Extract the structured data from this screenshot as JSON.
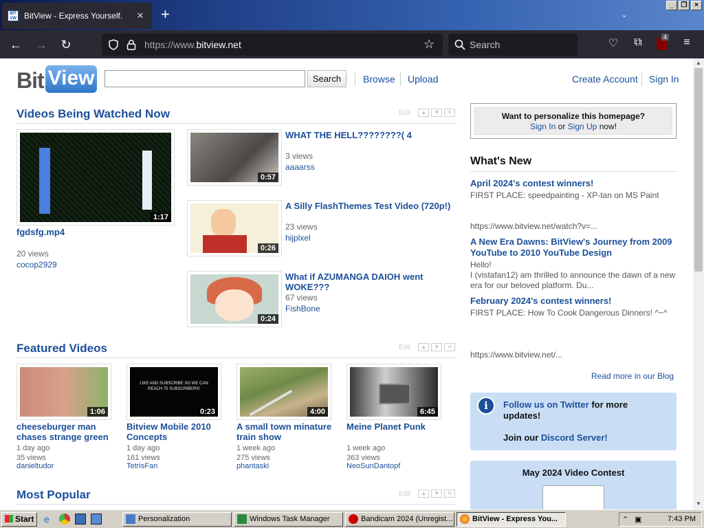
{
  "browser": {
    "tab_title": "BitView - Express Yourself.",
    "url_prefix": "https://www.",
    "url_domain": "bitview.net",
    "search_placeholder": "Search",
    "extension_badge": "4"
  },
  "site": {
    "logo_bit": "Bit",
    "logo_view": "View",
    "search_button": "Search",
    "nav": {
      "browse": "Browse",
      "upload": "Upload",
      "create_account": "Create Account",
      "sign_in": "Sign In"
    }
  },
  "sections": {
    "watched_now": "Videos Being Watched Now",
    "featured": "Featured Videos",
    "popular": "Most Popular",
    "edit_label": "Edit"
  },
  "watched_main": {
    "title": "fgdsfg.mp4",
    "duration": "1:17",
    "views": "20 views",
    "user": "cocop2929"
  },
  "watched_list": [
    {
      "title": "WHAT THE HELL????????( 4",
      "duration": "0:57",
      "views": "3 views",
      "user": "aaaarss"
    },
    {
      "title": "A Silly FlashThemes Test Video (720p!)",
      "duration": "0:26",
      "views": "23 views",
      "user": "hijplxel"
    },
    {
      "title": "What if AZUMANGA DAIOH went WOKE???",
      "duration": "0:24",
      "views": "67 views",
      "user": "FishBone"
    }
  ],
  "featured": [
    {
      "title": "cheeseburger man chases strange green",
      "duration": "1:06",
      "age": "1 day ago",
      "views": "35 views",
      "user": "danieltudor"
    },
    {
      "title": "Bitview Mobile 2010 Concepts",
      "duration": "0:23",
      "age": "1 day ago",
      "views": "161 views",
      "user": "TetrisFan"
    },
    {
      "title": "A small town minature train show",
      "duration": "4:00",
      "age": "1 week ago",
      "views": "275 views",
      "user": "phantaski"
    },
    {
      "title": "Meine Planet Punk",
      "duration": "6:45",
      "age": "1 week ago",
      "views": "363 views",
      "user": "NeoSunDantopf"
    }
  ],
  "featured_thumb_caption": "LIKE AND SUBSCRIBE SO WE CAN REACH 75 SUBSCRIBERS!",
  "sidebar": {
    "personalize_q": "Want to personalize this homepage?",
    "sign_in": "Sign In",
    "or": " or ",
    "sign_up": "Sign Up",
    "now": " now!",
    "whats_new": "What's New",
    "news": [
      {
        "title": "April 2024's contest winners!",
        "text": "FIRST PLACE: speedpainting - XP-tan on MS Paint",
        "link": "https://www.bitview.net/watch?v=..."
      },
      {
        "title": "A New Era Dawns: BitView's Journey from 2009 YouTube to 2010 YouTube Design",
        "text": "Hello!\nI (vistafan12) am thrilled to announce the dawn of a new era for our beloved platform. Du...",
        "link": ""
      },
      {
        "title": "February 2024's contest winners!",
        "text": "FIRST PLACE: How To Cook Dangerous Dinners! ^~^",
        "link": "https://www.bitview.net/..."
      }
    ],
    "read_more": "Read more in our Blog",
    "follow_pre": "Follow us on Twitter",
    "follow_post": " for more",
    "follow_post2": "updates!",
    "join_pre": "Join our ",
    "join_link": "Discord Server!",
    "contest_title": "May 2024 Video Contest"
  },
  "taskbar": {
    "start": "Start",
    "tasks": [
      "Personalization",
      "Windows Task Manager",
      "Bandicam 2024 (Unregist...",
      "BitView - Express You..."
    ],
    "clock": "7:43 PM"
  }
}
